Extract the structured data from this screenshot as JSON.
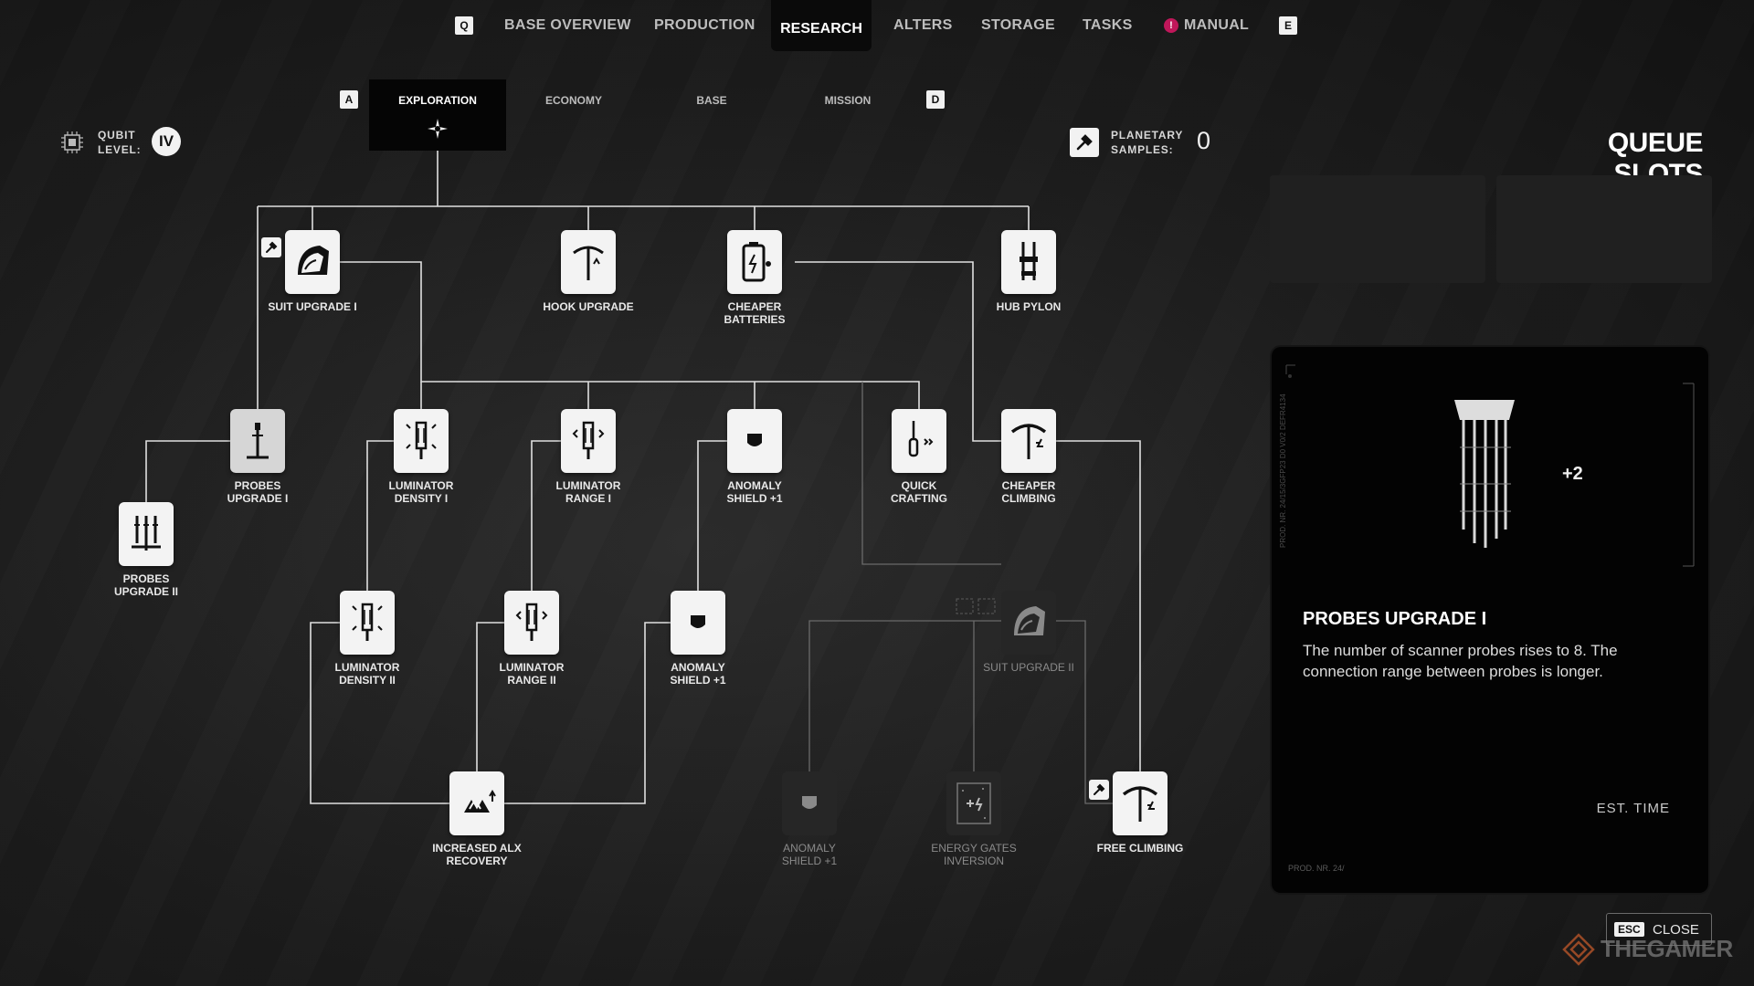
{
  "nav": {
    "key_left": "Q",
    "key_right": "E",
    "items": [
      "BASE OVERVIEW",
      "PRODUCTION",
      "RESEARCH",
      "ALTERS",
      "STORAGE",
      "TASKS",
      "MANUAL"
    ],
    "active": "RESEARCH",
    "manual_badge": "!"
  },
  "subtabs": {
    "key_left": "A",
    "key_right": "D",
    "items": [
      "EXPLORATION",
      "ECONOMY",
      "BASE",
      "MISSION"
    ],
    "active": "EXPLORATION"
  },
  "qubit": {
    "label": "QUBIT LEVEL:",
    "line1": "QUBIT",
    "line2": "LEVEL:",
    "value": "IV"
  },
  "samples": {
    "line1": "PLANETARY",
    "line2": "SAMPLES:",
    "value": "0"
  },
  "queue": {
    "title": "QUEUE SLOTS",
    "slots": 2
  },
  "tree": {
    "nodes": [
      {
        "id": "suit1",
        "label1": "SUIT UPGRADE I",
        "label2": "",
        "icon": "suit-helmet-icon"
      },
      {
        "id": "hook",
        "label1": "HOOK UPGRADE",
        "label2": "",
        "icon": "grappling-hook-icon"
      },
      {
        "id": "batteries",
        "label1": "CHEAPER",
        "label2": "BATTERIES",
        "icon": "battery-icon"
      },
      {
        "id": "hubpylon",
        "label1": "HUB PYLON",
        "label2": "",
        "icon": "pylon-icon"
      },
      {
        "id": "probes1",
        "label1": "PROBES",
        "label2": "UPGRADE I",
        "icon": "probe-icon",
        "selected": true
      },
      {
        "id": "lumdens1",
        "label1": "LUMINATOR",
        "label2": "DENSITY I",
        "icon": "luminator-density-icon"
      },
      {
        "id": "lumrange1",
        "label1": "LUMINATOR",
        "label2": "RANGE I",
        "icon": "luminator-range-icon"
      },
      {
        "id": "anomaly1",
        "label1": "ANOMALY",
        "label2": "SHIELD +1",
        "icon": "shield-icon"
      },
      {
        "id": "quickcraft",
        "label1": "QUICK",
        "label2": "CRAFTING",
        "icon": "screwdriver-icon"
      },
      {
        "id": "climbing",
        "label1": "CHEAPER",
        "label2": "CLIMBING",
        "icon": "pickaxe-icon"
      },
      {
        "id": "probes2",
        "label1": "PROBES",
        "label2": "UPGRADE II",
        "icon": "probes-icon"
      },
      {
        "id": "lumdens2",
        "label1": "LUMINATOR",
        "label2": "DENSITY II",
        "icon": "luminator-density-icon"
      },
      {
        "id": "lumrange2",
        "label1": "LUMINATOR",
        "label2": "RANGE II",
        "icon": "luminator-range-icon"
      },
      {
        "id": "anomaly2",
        "label1": "ANOMALY",
        "label2": "SHIELD +1",
        "icon": "shield-icon"
      },
      {
        "id": "suit2",
        "label1": "SUIT UPGRADE II",
        "label2": "",
        "icon": "suit-helmet-icon",
        "locked": true
      },
      {
        "id": "alx",
        "label1": "INCREASED ALX",
        "label2": "RECOVERY",
        "icon": "alx-icon"
      },
      {
        "id": "anomaly3",
        "label1": "ANOMALY",
        "label2": "SHIELD +1",
        "icon": "shield-icon",
        "locked": true
      },
      {
        "id": "gates",
        "label1": "ENERGY GATES",
        "label2": "INVERSION",
        "icon": "energy-gate-icon",
        "locked": true
      },
      {
        "id": "freeclimb",
        "label1": "FREE CLIMBING",
        "label2": "",
        "icon": "pickaxe-icon"
      }
    ]
  },
  "detail": {
    "title": "PROBES UPGRADE I",
    "description": "The number of scanner probes rises to 8. The connection range between probes is longer.",
    "badge": "+2",
    "est_time_label": "EST. TIME",
    "prod_label": "PROD. NR. 24/",
    "side_text": "PROD. NR. 24/15/3GFP23 D0 V0/2  DEFR4134"
  },
  "close": {
    "key": "ESC",
    "label": "CLOSE"
  },
  "watermark": "THEGAMER"
}
